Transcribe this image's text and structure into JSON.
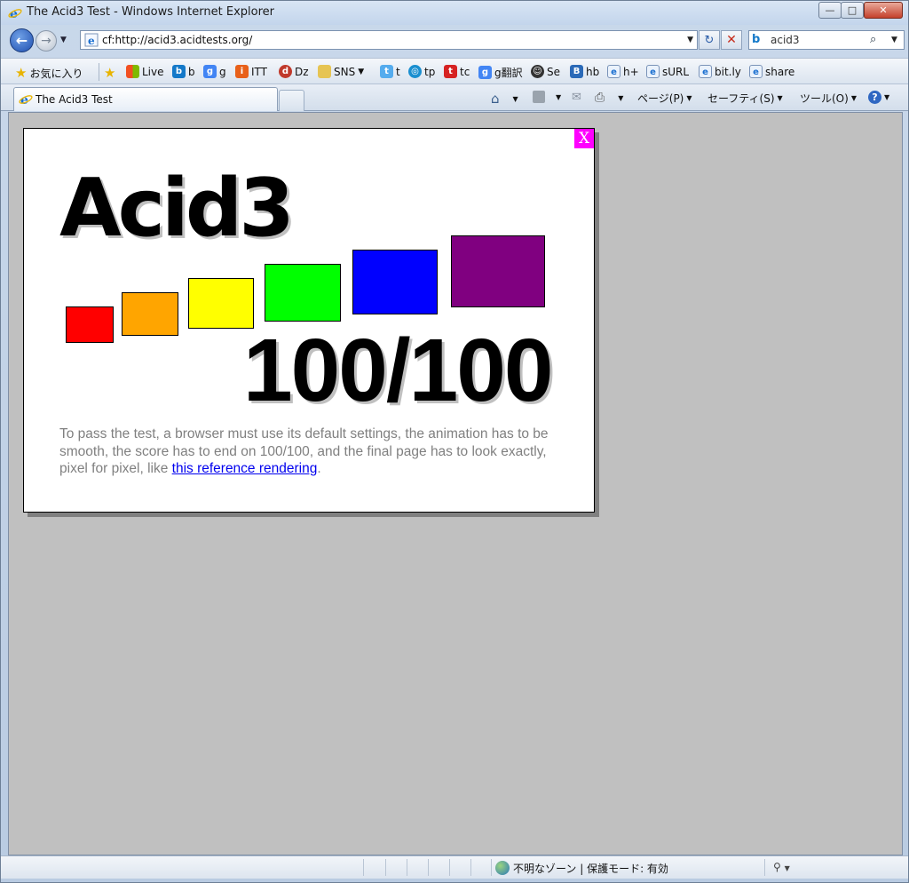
{
  "window": {
    "title": "The Acid3 Test - Windows Internet Explorer",
    "minimize_label": "—",
    "maximize_label": "□",
    "close_label": "✕"
  },
  "nav": {
    "back_label": "←",
    "forward_label": "→",
    "address": "cf:http://acid3.acidtests.org/",
    "refresh_label": "↻",
    "stop_label": "✕",
    "search_value": "acid3",
    "search_logo": "b"
  },
  "favorites": {
    "favorites_label": "お気に入り",
    "items": [
      "Live",
      "b",
      "g",
      "ITT",
      "Dz",
      "SNS",
      "t",
      "tp",
      "tc",
      "g翻訳",
      "Se",
      "hb",
      "h+",
      "sURL",
      "bit.ly",
      "share"
    ]
  },
  "tabs": {
    "active_label": "The Acid3 Test"
  },
  "commands": {
    "page": "ページ(P)",
    "safety": "セーフティ(S)",
    "tools": "ツール(O)"
  },
  "acid3": {
    "close_label": "X",
    "title": "Acid3",
    "score": "100/100",
    "desc_text": "To pass the test, a browser must use its default settings, the animation has to be smooth, the score has to end on 100/100, and the final page has to look exactly, pixel for pixel, like ",
    "link_text": "this reference rendering",
    "desc_end": ".",
    "buckets": [
      {
        "color": "#ff0000"
      },
      {
        "color": "#ffa500"
      },
      {
        "color": "#ffff00"
      },
      {
        "color": "#00ff00"
      },
      {
        "color": "#0000ff"
      },
      {
        "color": "#800080"
      }
    ]
  },
  "status": {
    "zone_text": "不明なゾーン | 保護モード: 有効"
  }
}
